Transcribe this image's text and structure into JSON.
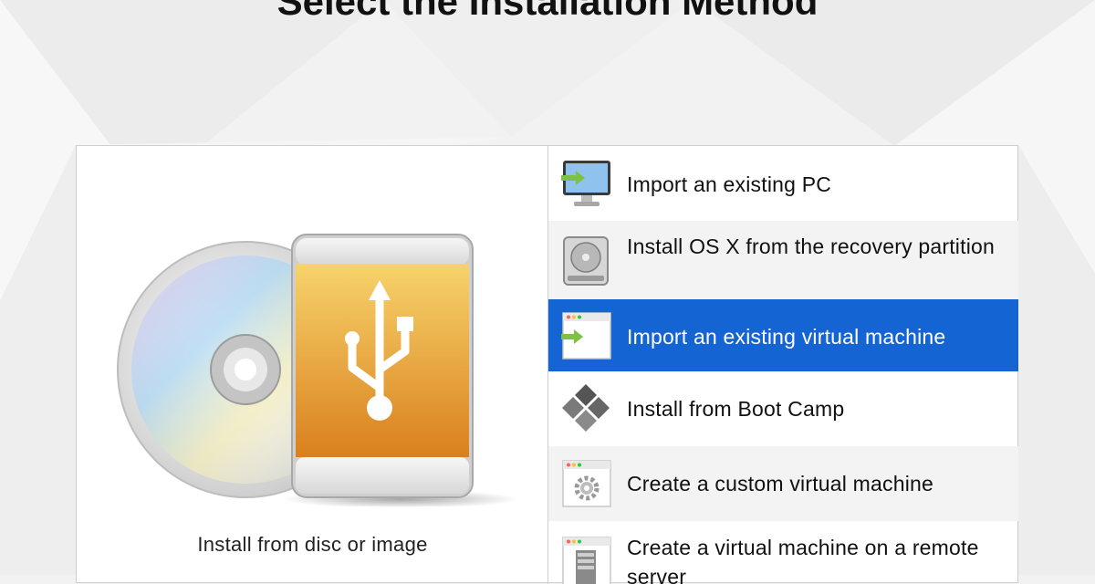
{
  "page": {
    "title": "Select the Installation Method"
  },
  "hero_option": {
    "label": "Install from disc or image",
    "icons": [
      "disc-icon",
      "usb-drive-icon"
    ]
  },
  "options": [
    {
      "label": "Import an existing PC",
      "icon": "monitor-import-icon",
      "selected": false
    },
    {
      "label": "Install OS X from the recovery partition",
      "icon": "hard-drive-icon",
      "selected": false
    },
    {
      "label": "Import an existing virtual machine",
      "icon": "window-import-icon",
      "selected": true
    },
    {
      "label": "Install from Boot Camp",
      "icon": "windows-logo-icon",
      "selected": false
    },
    {
      "label": "Create a custom virtual machine",
      "icon": "window-gear-icon",
      "selected": false
    },
    {
      "label": "Create a virtual machine on a remote server",
      "icon": "server-icon",
      "selected": false
    }
  ],
  "colors": {
    "selection": "#1464d4",
    "usb_top": "#f7d36b",
    "usb_bottom": "#d9801e",
    "import_arrow": "#7dc242"
  }
}
